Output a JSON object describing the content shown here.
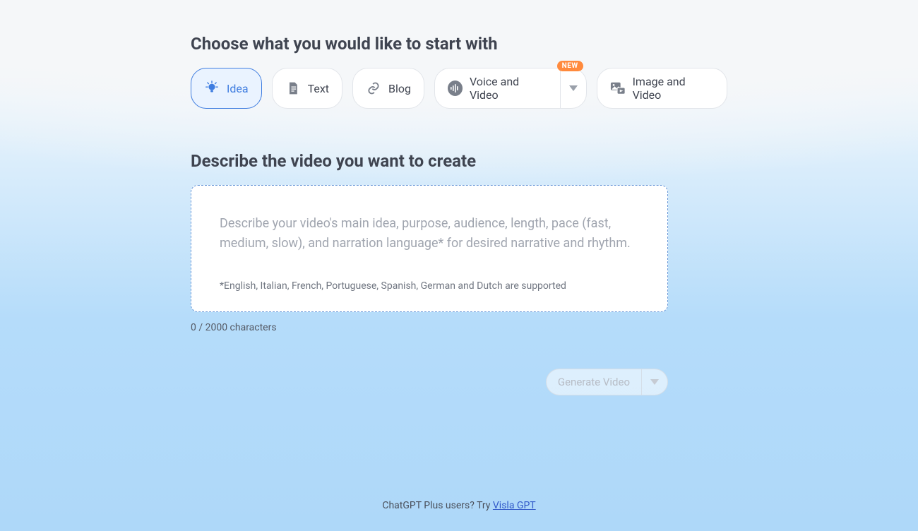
{
  "headings": {
    "choose": "Choose what you would like to start with",
    "describe": "Describe the video you want to create"
  },
  "tabs": {
    "idea": "Idea",
    "text": "Text",
    "blog": "Blog",
    "voiceVideo": "Voice and Video",
    "imageVideo": "Image and Video",
    "newBadge": "NEW"
  },
  "input": {
    "placeholder": "Describe your video's main idea, purpose, audience, length, pace (fast, medium, slow), and narration language* for desired narrative and rhythm.",
    "footnote": "*English, Italian, French, Portuguese, Spanish, German and Dutch are supported",
    "charCount": "0 / 2000 characters"
  },
  "generate": {
    "label": "Generate Video"
  },
  "footer": {
    "prefix": "ChatGPT Plus users? Try ",
    "linkText": "Visla GPT"
  }
}
